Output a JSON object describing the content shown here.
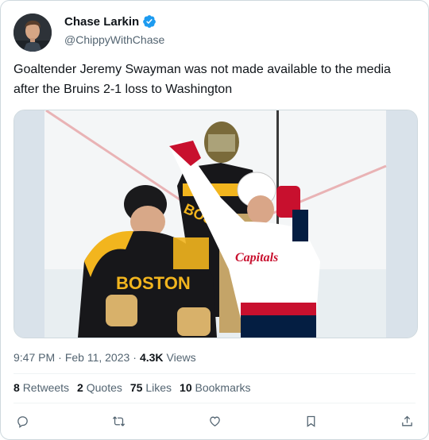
{
  "author": {
    "display_name": "Chase Larkin",
    "handle": "@ChippyWithChase",
    "verified": true,
    "badge_color": "#1d9bf0"
  },
  "tweet": {
    "text": "Goaltender Jeremy Swayman was not made available to the media after the Bruins 2-1 loss to Washington"
  },
  "media": {
    "jersey_left_text": "BOSTON",
    "jersey_goalie_text": "BOSTON",
    "jersey_right_text": "Capitals"
  },
  "meta": {
    "time": "9:47 PM",
    "date": "Feb 11, 2023",
    "separator": "·",
    "views_count": "4.3K",
    "views_label": "Views"
  },
  "stats": {
    "retweets_count": "8",
    "retweets_label": "Retweets",
    "quotes_count": "2",
    "quotes_label": "Quotes",
    "likes_count": "75",
    "likes_label": "Likes",
    "bookmarks_count": "10",
    "bookmarks_label": "Bookmarks"
  },
  "colors": {
    "text_primary": "#0f1419",
    "text_secondary": "#536471",
    "divider": "#eff3f4",
    "bruins_gold": "#f2b51e",
    "capitals_red": "#c8102e",
    "capitals_navy": "#041e42"
  },
  "icons": [
    "verified-badge-icon",
    "reply-icon",
    "retweet-icon",
    "like-icon",
    "bookmark-icon",
    "share-icon"
  ]
}
